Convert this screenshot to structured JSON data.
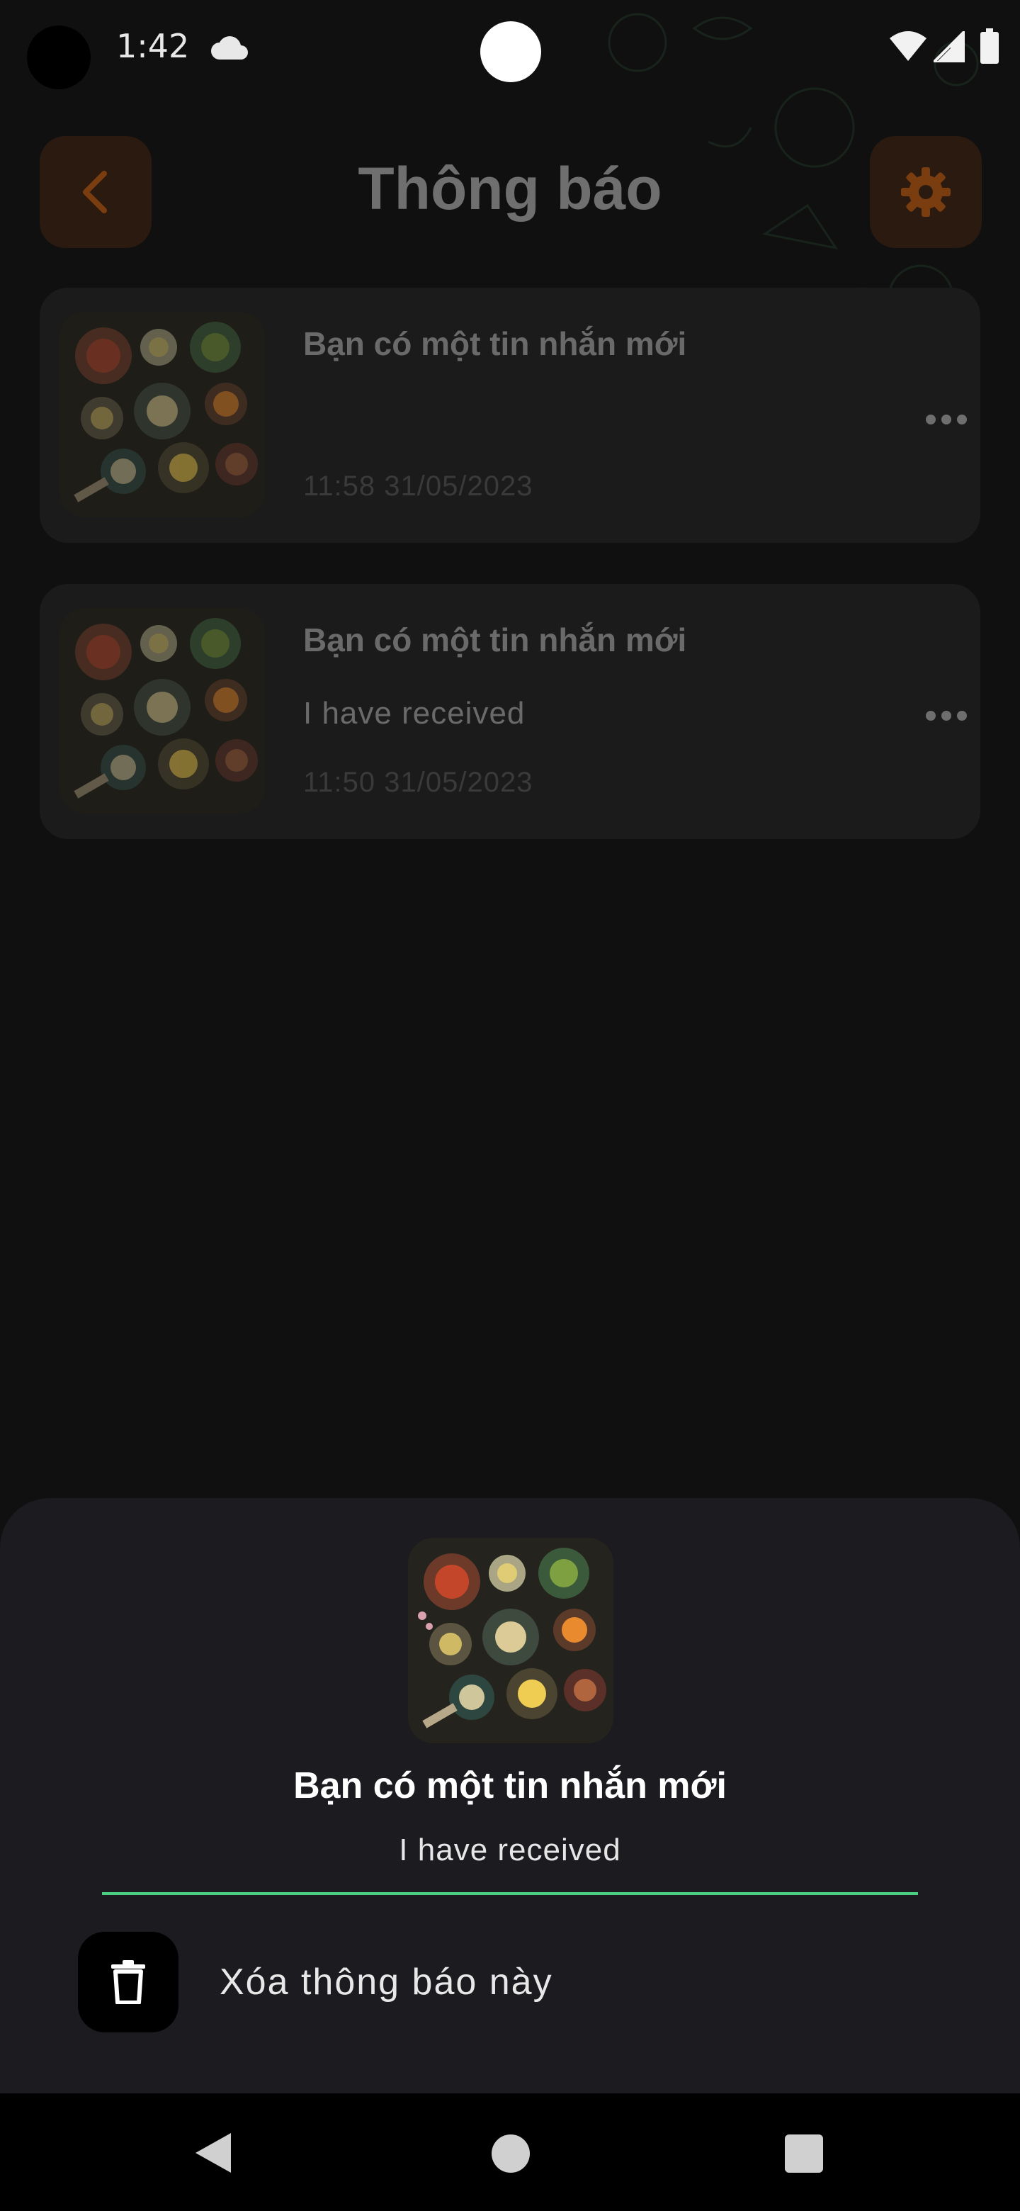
{
  "status_bar": {
    "time": "1:42",
    "icons": [
      "cloud-icon",
      "wifi-icon",
      "signal-icon",
      "battery-icon"
    ]
  },
  "header": {
    "title": "Thông báo",
    "back_icon": "chevron-left-icon",
    "settings_icon": "gear-icon"
  },
  "notifications": [
    {
      "title": "Bạn có một tin nhắn mới",
      "body": "",
      "time": "11:58 31/05/2023",
      "thumbnail": "food-platter-image"
    },
    {
      "title": "Bạn có một tin nhắn mới",
      "body": "I have received",
      "time": "11:50 31/05/2023",
      "thumbnail": "food-platter-image"
    }
  ],
  "bottom_sheet": {
    "title": "Bạn có một tin nhắn mới",
    "body": "I have received",
    "delete_label": "Xóa thông báo này",
    "delete_icon": "trash-icon"
  },
  "colors": {
    "accent": "#c4620f",
    "divider": "#4ccf7f",
    "sheet_bg": "#1c1b1f",
    "card_bg": "#1b1b1b"
  },
  "nav_bar": {
    "icons": [
      "nav-back-icon",
      "nav-home-icon",
      "nav-recents-icon"
    ]
  }
}
